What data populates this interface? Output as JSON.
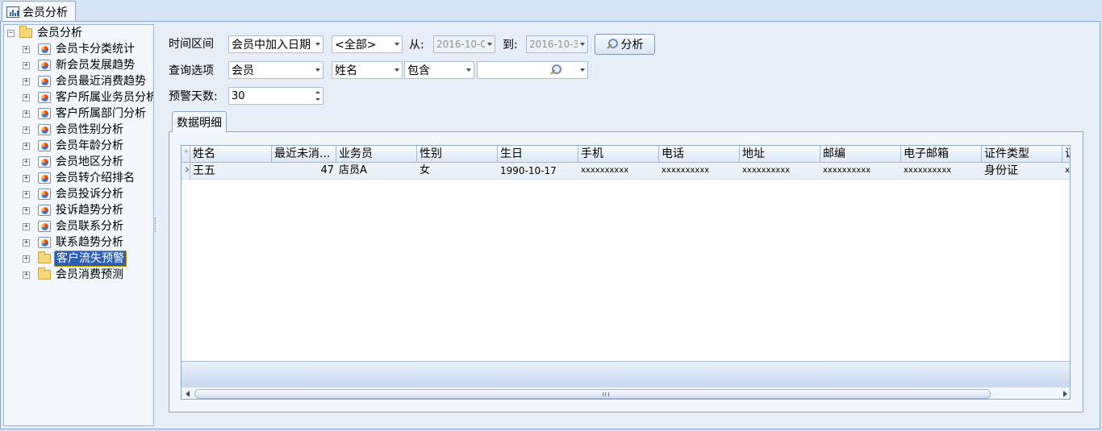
{
  "doc_tab": {
    "label": "会员分析"
  },
  "tree": {
    "root": "会员分析",
    "items": [
      {
        "label": "会员卡分类统计",
        "icon": "chart"
      },
      {
        "label": "新会员发展趋势",
        "icon": "chart"
      },
      {
        "label": "会员最近消费趋势",
        "icon": "chart"
      },
      {
        "label": "客户所属业务员分析",
        "icon": "chart"
      },
      {
        "label": "客户所属部门分析",
        "icon": "chart"
      },
      {
        "label": "会员性别分析",
        "icon": "chart"
      },
      {
        "label": "会员年龄分析",
        "icon": "chart"
      },
      {
        "label": "会员地区分析",
        "icon": "chart"
      },
      {
        "label": "会员转介绍排名",
        "icon": "chart"
      },
      {
        "label": "会员投诉分析",
        "icon": "chart"
      },
      {
        "label": "投诉趋势分析",
        "icon": "chart"
      },
      {
        "label": "会员联系分析",
        "icon": "chart"
      },
      {
        "label": "联系趋势分析",
        "icon": "chart"
      },
      {
        "label": "客户流失预警",
        "icon": "folder",
        "selected": true
      },
      {
        "label": "会员消费预测",
        "icon": "folder"
      }
    ]
  },
  "filters": {
    "time_label": "时间区间",
    "time_field": "会员中加入日期",
    "time_scope": "<全部>",
    "from_label": "从:",
    "from_value": "2016-10-0",
    "to_label": "到:",
    "to_value": "2016-10-3",
    "analyze_button": "分析",
    "query_label": "查询选项",
    "query_target": "会员",
    "query_field": "姓名",
    "query_op": "包含",
    "query_value": "",
    "warn_label": "预警天数:",
    "warn_days": "30"
  },
  "tab": {
    "label": "数据明细"
  },
  "table": {
    "columns": [
      "姓名",
      "最近未消...",
      "业务员",
      "性别",
      "生日",
      "手机",
      "电话",
      "地址",
      "邮编",
      "电子邮箱",
      "证件类型",
      "证"
    ],
    "rows": [
      [
        "王五",
        "47",
        "店员A",
        "女",
        "1990-10-17",
        "xxxxxxxxxx",
        "xxxxxxxxxx",
        "xxxxxxxxxx",
        "xxxxxxxxxx",
        "xxxxxxxxxx",
        "身份证",
        "xx"
      ]
    ]
  }
}
